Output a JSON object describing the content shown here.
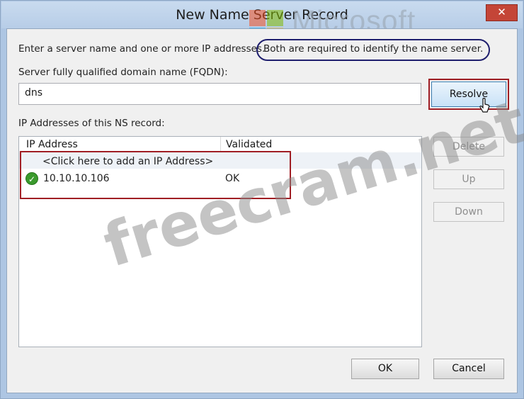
{
  "window": {
    "title": "New Name Server Record",
    "close_glyph": "✕"
  },
  "instructions": {
    "text_part1": "Enter a server name and one or more IP addresses.",
    "text_part2": "Both are required to identify the name server."
  },
  "fqdn": {
    "label": "Server fully qualified domain name (FQDN):",
    "value": "dns"
  },
  "buttons": {
    "resolve": "Resolve",
    "delete": "Delete",
    "up": "Up",
    "down": "Down",
    "ok": "OK",
    "cancel": "Cancel"
  },
  "ip_list": {
    "label": "IP Addresses of this NS record:",
    "columns": [
      "IP Address",
      "Validated"
    ],
    "add_prompt": "<Click here to add an IP Address>",
    "rows": [
      {
        "ip": "10.10.10.106",
        "validated": "OK",
        "status_icon": "check-icon"
      }
    ]
  },
  "watermarks": {
    "brand": "Microsoft",
    "site": "freecram.net"
  },
  "colors": {
    "highlight_red": "#a01e24",
    "oval_blue": "#1f1f6e",
    "check_green": "#3a9a2c"
  }
}
